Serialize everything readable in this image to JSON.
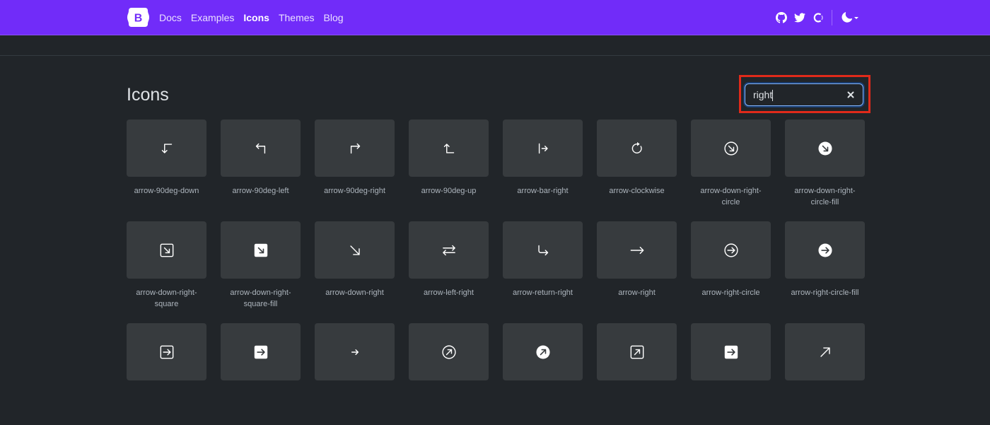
{
  "nav": {
    "brand_letter": "B",
    "links": [
      "Docs",
      "Examples",
      "Icons",
      "Themes",
      "Blog"
    ],
    "active": "Icons",
    "icons": [
      "github-icon",
      "twitter-icon",
      "opencollective-icon",
      "theme-toggle-icon"
    ],
    "accent": "#712cf9"
  },
  "page": {
    "title": "Icons"
  },
  "search": {
    "value": "right"
  },
  "icons": [
    {
      "label": "arrow-90deg-down",
      "glyph": "arrow-90deg-down"
    },
    {
      "label": "arrow-90deg-left",
      "glyph": "arrow-90deg-left"
    },
    {
      "label": "arrow-90deg-right",
      "glyph": "arrow-90deg-right"
    },
    {
      "label": "arrow-90deg-up",
      "glyph": "arrow-90deg-up"
    },
    {
      "label": "arrow-bar-right",
      "glyph": "arrow-bar-right"
    },
    {
      "label": "arrow-clockwise",
      "glyph": "arrow-clockwise"
    },
    {
      "label": "arrow-down-right-circle",
      "glyph": "arrow-down-right-circle"
    },
    {
      "label": "arrow-down-right-circle-fill",
      "glyph": "arrow-down-right-circle-fill"
    },
    {
      "label": "arrow-down-right-square",
      "glyph": "arrow-down-right-square"
    },
    {
      "label": "arrow-down-right-square-fill",
      "glyph": "arrow-down-right-square-fill"
    },
    {
      "label": "arrow-down-right",
      "glyph": "arrow-down-right"
    },
    {
      "label": "arrow-left-right",
      "glyph": "arrow-left-right"
    },
    {
      "label": "arrow-return-right",
      "glyph": "arrow-return-right"
    },
    {
      "label": "arrow-right",
      "glyph": "arrow-right"
    },
    {
      "label": "arrow-right-circle",
      "glyph": "arrow-right-circle"
    },
    {
      "label": "arrow-right-circle-fill",
      "glyph": "arrow-right-circle-fill"
    },
    {
      "label": "",
      "glyph": "arrow-right-square"
    },
    {
      "label": "",
      "glyph": "arrow-right-square-fill"
    },
    {
      "label": "",
      "glyph": "arrow-right-short"
    },
    {
      "label": "",
      "glyph": "arrow-up-right-circle"
    },
    {
      "label": "",
      "glyph": "arrow-up-right-circle-fill"
    },
    {
      "label": "",
      "glyph": "arrow-up-right-square"
    },
    {
      "label": "",
      "glyph": "arrow-up-right-square-fill"
    },
    {
      "label": "",
      "glyph": "arrow-up-right"
    }
  ]
}
